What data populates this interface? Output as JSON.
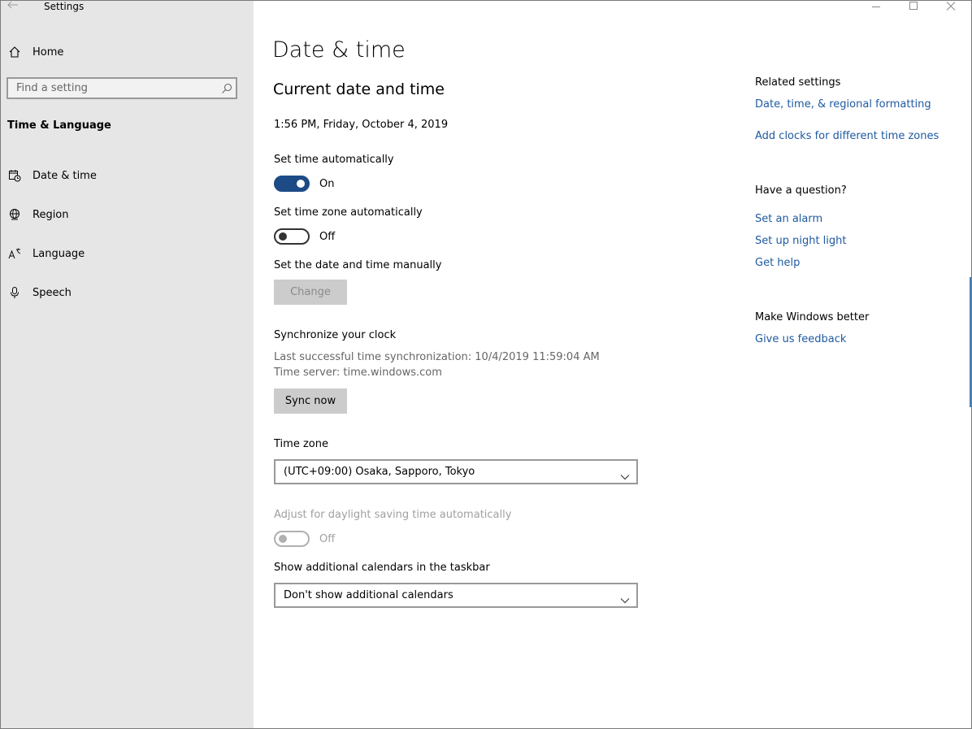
{
  "window": {
    "title": "Settings"
  },
  "sidebar": {
    "home_label": "Home",
    "search_placeholder": "Find a setting",
    "section_title": "Time & Language",
    "items": [
      {
        "label": "Date & time",
        "icon": "calendar-clock-icon"
      },
      {
        "label": "Region",
        "icon": "globe-icon"
      },
      {
        "label": "Language",
        "icon": "language-icon"
      },
      {
        "label": "Speech",
        "icon": "microphone-icon"
      }
    ]
  },
  "main": {
    "title": "Date & time",
    "section_title": "Current date and time",
    "current_datetime": "1:56 PM, Friday, October 4, 2019",
    "set_time_auto": {
      "label": "Set time automatically",
      "state": "On"
    },
    "set_tz_auto": {
      "label": "Set time zone automatically",
      "state": "Off"
    },
    "manual": {
      "label": "Set the date and time manually",
      "button": "Change"
    },
    "sync": {
      "title": "Synchronize your clock",
      "last_sync": "Last successful time synchronization: 10/4/2019 11:59:04 AM",
      "server": "Time server: time.windows.com",
      "button": "Sync now"
    },
    "timezone": {
      "label": "Time zone",
      "value": "(UTC+09:00) Osaka, Sapporo, Tokyo"
    },
    "dst": {
      "label": "Adjust for daylight saving time automatically",
      "state": "Off"
    },
    "calendars": {
      "label": "Show additional calendars in the taskbar",
      "value": "Don't show additional calendars"
    }
  },
  "related": {
    "title": "Related settings",
    "links": [
      "Date, time, & regional formatting",
      "Add clocks for different time zones"
    ]
  },
  "question": {
    "title": "Have a question?",
    "links": [
      "Set an alarm",
      "Set up night light",
      "Get help"
    ]
  },
  "better": {
    "title": "Make Windows better",
    "link": "Give us feedback"
  },
  "colors": {
    "accent": "#1c4b86",
    "link": "#1e5aa0",
    "sidebar_bg": "#e6e6e6"
  }
}
